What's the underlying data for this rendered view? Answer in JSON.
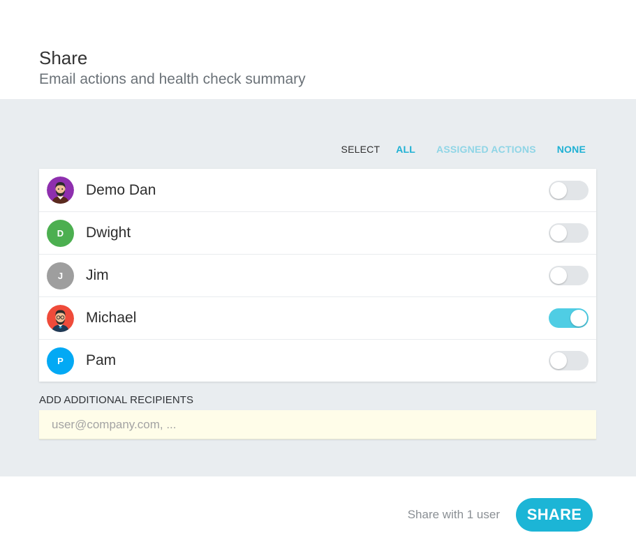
{
  "dialog": {
    "title": "Share",
    "subtitle": "Email actions and health check summary"
  },
  "select": {
    "label": "SELECT",
    "options": [
      "ALL",
      "ASSIGNED ACTIONS",
      "NONE"
    ]
  },
  "users": [
    {
      "name": "Demo Dan",
      "avatar_type": "illustration",
      "avatar_color": "#8e2fae",
      "initial": "",
      "selected": false
    },
    {
      "name": "Dwight",
      "avatar_type": "initial",
      "avatar_color": "#4caf50",
      "initial": "D",
      "selected": false
    },
    {
      "name": "Jim",
      "avatar_type": "initial",
      "avatar_color": "#9e9e9e",
      "initial": "J",
      "selected": false
    },
    {
      "name": "Michael",
      "avatar_type": "illustration",
      "avatar_color": "#ef4b3a",
      "initial": "",
      "selected": true
    },
    {
      "name": "Pam",
      "avatar_type": "initial",
      "avatar_color": "#03a9f4",
      "initial": "P",
      "selected": false
    }
  ],
  "recipients": {
    "label": "ADD ADDITIONAL RECIPIENTS",
    "value": "",
    "placeholder": "user@company.com, ..."
  },
  "footer": {
    "share_count_text": "Share with 1 user",
    "share_button_label": "SHARE"
  },
  "colors": {
    "accent": "#1cb5d6",
    "toggle_on": "#4fcde4",
    "toggle_off": "#e2e5e8",
    "body_bg": "#e9edf0",
    "input_bg": "#fffde9"
  }
}
